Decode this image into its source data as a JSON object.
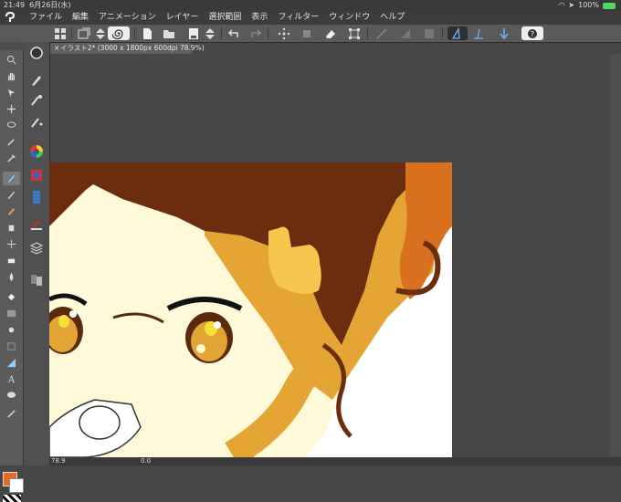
{
  "status": {
    "time": "21:49",
    "date": "6月26日(水)",
    "battery": "100%"
  },
  "menu": [
    "ファイル",
    "編集",
    "アニメーション",
    "レイヤー",
    "選択範囲",
    "表示",
    "フィルター",
    "ウィンドウ",
    "ヘルプ"
  ],
  "document_tab": {
    "close": "×",
    "title": "イラスト2* (3000 x 1800px 600dpi 78.9%)"
  },
  "bottom": {
    "zoom": "78.9",
    "angle": "0.0"
  },
  "colors": {
    "main": "#e86a1e",
    "sub": "#ffffff",
    "accent": "#2f78c4"
  }
}
